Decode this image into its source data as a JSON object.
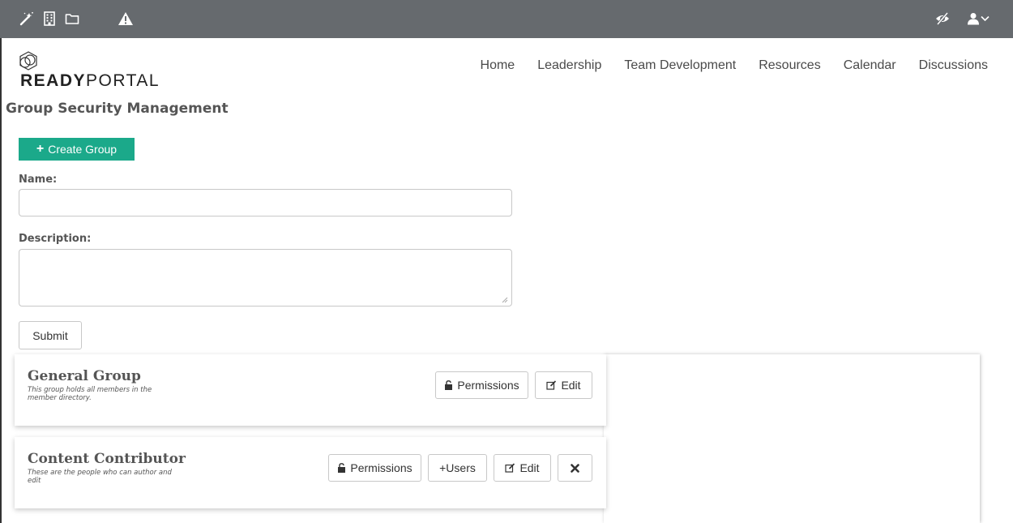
{
  "topbar": {
    "icons": [
      "magic-wand-icon",
      "building-icon",
      "folder-icon",
      "warning-icon"
    ],
    "right_icons": [
      "eye-slash-icon",
      "user-icon",
      "chevron-down-icon"
    ],
    "bg_color": "#666a6e"
  },
  "header": {
    "logo_bold": "READY",
    "logo_light": "PORTAL",
    "nav": [
      "Home",
      "Leadership",
      "Team Development",
      "Resources",
      "Calendar",
      "Discussions"
    ]
  },
  "page": {
    "title": "Group Security Management"
  },
  "form": {
    "create_label": "Create Group",
    "name_label": "Name:",
    "name_value": "",
    "description_label": "Description:",
    "description_value": "",
    "submit_label": "Submit",
    "accent_color": "#1ba98a"
  },
  "groups": [
    {
      "title": "General Group",
      "description": "This group holds all members in the member directory.",
      "permissions_label": "Permissions",
      "edit_label": "Edit"
    },
    {
      "title": "Content Contributor",
      "description": "These are the people who can author and edit",
      "permissions_label": "Permissions",
      "users_label": "+Users",
      "edit_label": "Edit",
      "delete_icon": "close-icon"
    }
  ]
}
